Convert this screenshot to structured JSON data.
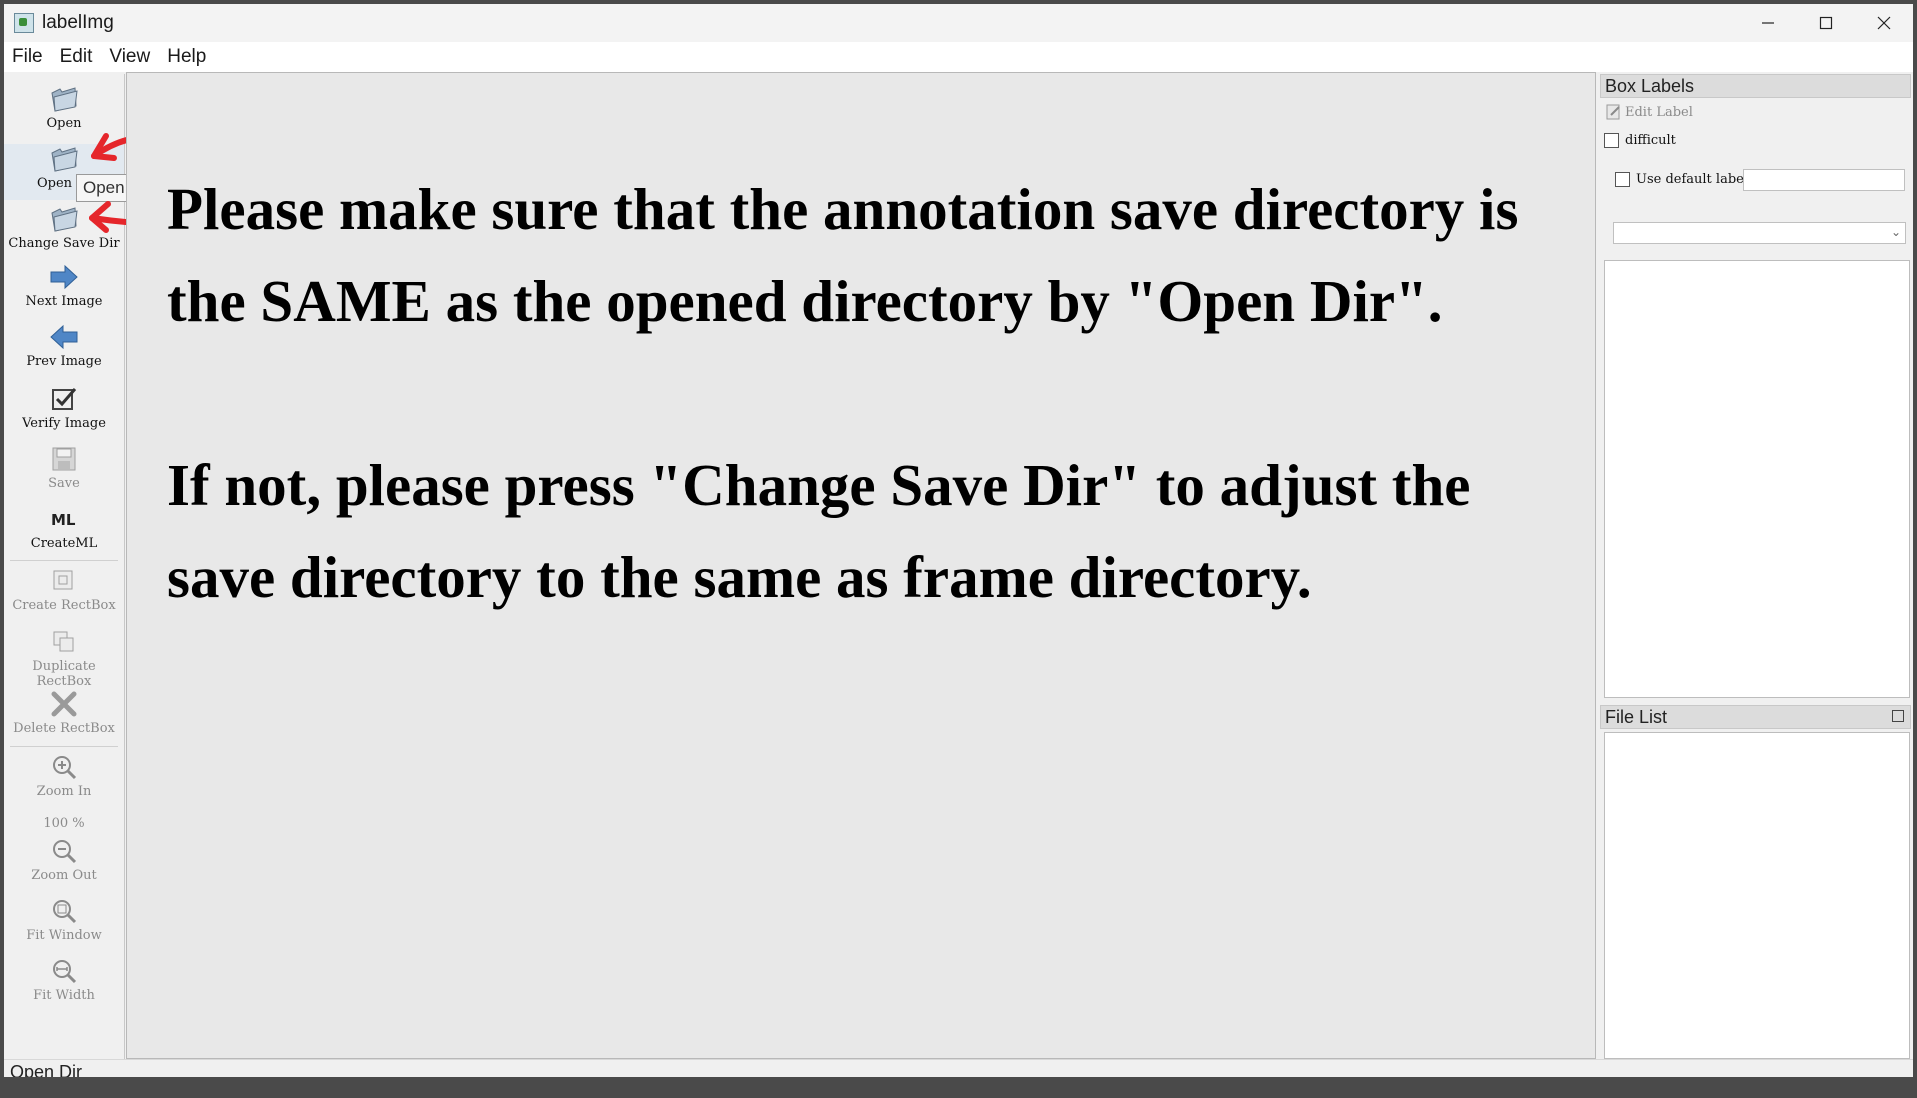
{
  "window": {
    "title": "labelImg"
  },
  "menu": [
    "File",
    "Edit",
    "View",
    "Help"
  ],
  "toolbar": {
    "open": "Open",
    "open_dir": "Open",
    "change_save_dir": "Change Save Dir",
    "next_image": "Next Image",
    "prev_image": "Prev Image",
    "verify_image": "Verify Image",
    "save": "Save",
    "format": "CreateML",
    "create_rectbox": "Create RectBox",
    "duplicate_rectbox": "Duplicate RectBox",
    "delete_rectbox": "Delete RectBox",
    "zoom_in": "Zoom In",
    "zoom_level": "100 %",
    "zoom_out": "Zoom Out",
    "fit_window": "Fit Window",
    "fit_width": "Fit Width"
  },
  "tooltip": "Open Dir",
  "canvas_message": {
    "paragraph1": "Please make sure that the annotation save directory is the SAME as the opened directory by \"Open Dir\".",
    "paragraph2": "If not, please press \"Change Save Dir\" to adjust the save directory to the same as frame directory."
  },
  "box_labels": {
    "title": "Box Labels",
    "edit_label": "Edit Label",
    "difficult": "difficult",
    "use_default_label": "Use default label",
    "default_label_value": ""
  },
  "file_list": {
    "title": "File List"
  },
  "status": "Open Dir",
  "colors": {
    "annotation_arrow": "#e5262b",
    "canvas_bg": "#e8e8e8"
  }
}
